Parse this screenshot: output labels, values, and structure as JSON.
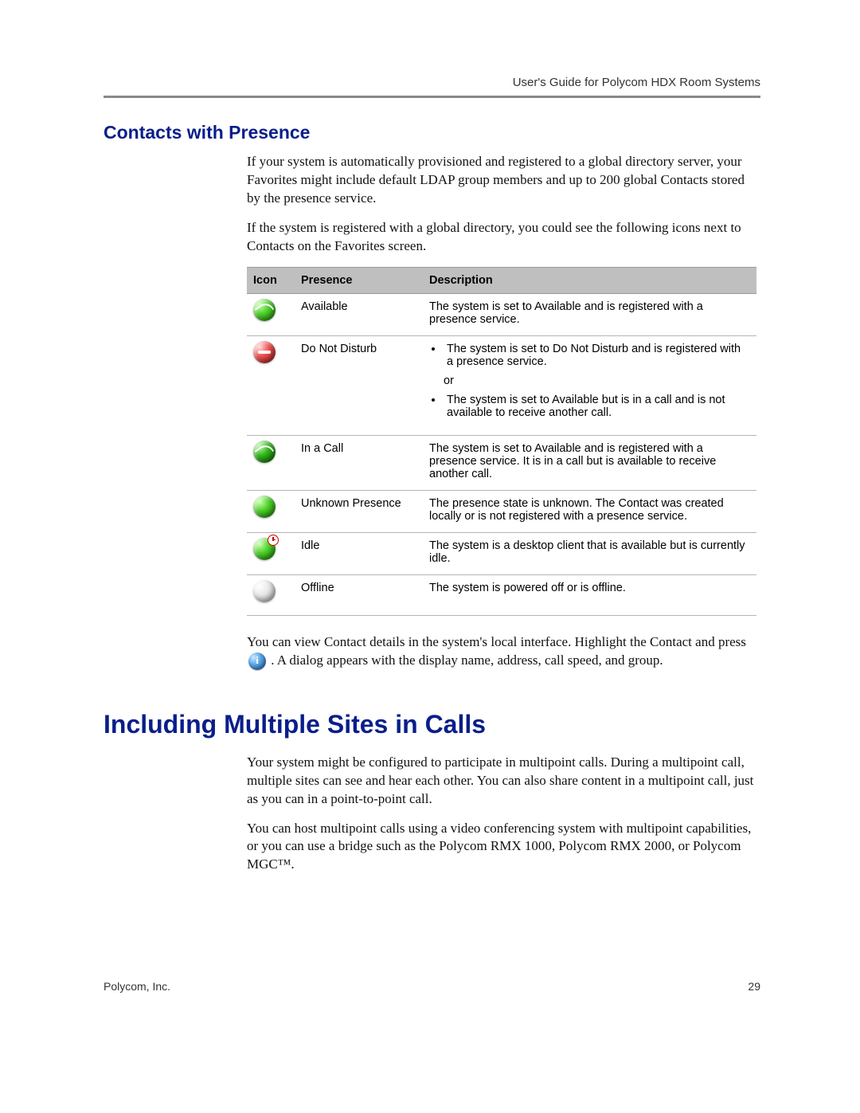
{
  "header": {
    "doc_title": "User's Guide for Polycom HDX Room Systems"
  },
  "section1": {
    "heading": "Contacts with Presence",
    "p1": "If your system is automatically provisioned and registered to a global directory server, your Favorites might include default LDAP group members and up to 200 global Contacts stored by the presence service.",
    "p2": "If the system is registered with a global directory, you could see the following icons next to Contacts on the Favorites screen."
  },
  "table": {
    "headers": {
      "icon": "Icon",
      "presence": "Presence",
      "description": "Description"
    },
    "rows": [
      {
        "presence": "Available",
        "description": "The system is set to Available and is registered with a presence service."
      },
      {
        "presence": "Do Not Disturb",
        "desc_items": [
          "The system is set to Do Not Disturb and is registered with a presence service.",
          "The system is set to Available but is in a call and is not available to receive another call."
        ],
        "or": "or"
      },
      {
        "presence": "In a Call",
        "description": "The system is set to Available and is registered with a presence service. It is in a call but is available to receive another call."
      },
      {
        "presence": "Unknown Presence",
        "description": "The presence state is unknown. The Contact was created locally or is not registered with a presence service."
      },
      {
        "presence": "Idle",
        "description": "The system is a desktop client that is available but is currently idle."
      },
      {
        "presence": "Offline",
        "description": "The system is powered off or is offline."
      }
    ]
  },
  "after_table": {
    "p1a": "You can view Contact details in the system's local interface. Highlight the Contact and press ",
    "p1b": ". A dialog appears with the display name, address, call speed, and group."
  },
  "section2": {
    "heading": "Including Multiple Sites in Calls",
    "p1": "Your system might be configured to participate in multipoint calls. During a multipoint call, multiple sites can see and hear each other. You can also share content in a multipoint call, just as you can in a point-to-point call.",
    "p2": "You can host multipoint calls using a video conferencing system with multipoint capabilities, or you can use a bridge such as the Polycom RMX 1000, Polycom RMX 2000, or Polycom MGC™."
  },
  "footer": {
    "company": "Polycom, Inc.",
    "page": "29"
  }
}
